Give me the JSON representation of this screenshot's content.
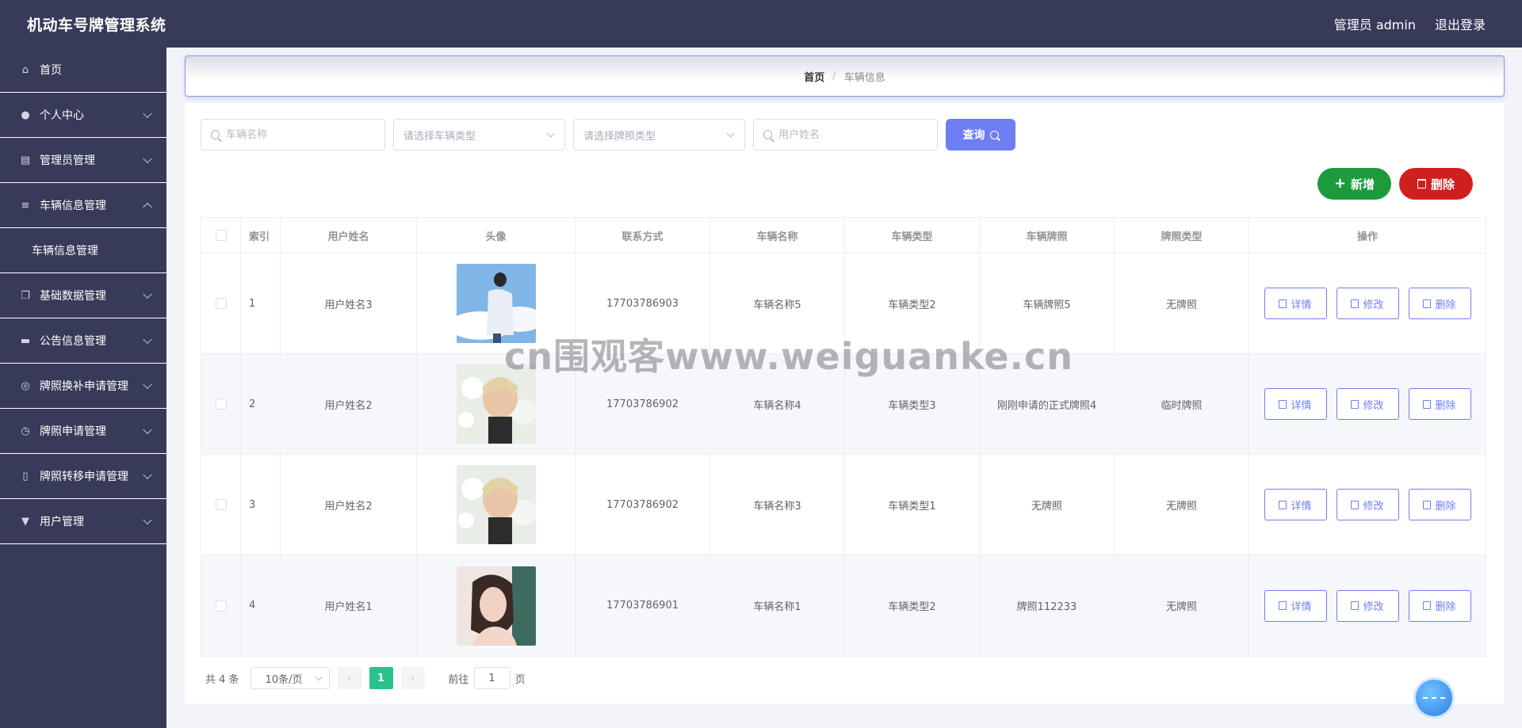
{
  "header": {
    "app_title": "机动车号牌管理系统",
    "user_label": "管理员 admin",
    "logout_label": "退出登录"
  },
  "sidebar": {
    "items": [
      {
        "label": "首页",
        "icon": "home-icon"
      },
      {
        "label": "个人中心",
        "icon": "user-icon"
      },
      {
        "label": "管理员管理",
        "icon": "chart-icon"
      },
      {
        "label": "车辆信息管理",
        "icon": "list-icon",
        "sub": "车辆信息管理"
      },
      {
        "label": "基础数据管理",
        "icon": "copy-icon"
      },
      {
        "label": "公告信息管理",
        "icon": "monitor-icon"
      },
      {
        "label": "牌照换补申请管理",
        "icon": "compass-icon"
      },
      {
        "label": "牌照申请管理",
        "icon": "clock-icon"
      },
      {
        "label": "牌照转移申请管理",
        "icon": "phone-icon"
      },
      {
        "label": "用户管理",
        "icon": "stamp-icon"
      }
    ]
  },
  "breadcrumb": {
    "home": "首页",
    "separator": "/",
    "current": "车辆信息"
  },
  "filters": {
    "vehicle_name_placeholder": "车辆名称",
    "vehicle_type_placeholder": "请选择车辆类型",
    "plate_type_placeholder": "请选择牌照类型",
    "user_name_placeholder": "用户姓名",
    "query_label": "查询"
  },
  "actions": {
    "add_label": "新增",
    "delete_label": "删除"
  },
  "table": {
    "headers": [
      "索引",
      "用户姓名",
      "头像",
      "联系方式",
      "车辆名称",
      "车辆类型",
      "车辆牌照",
      "牌照类型",
      "操作"
    ],
    "rows": [
      {
        "index": "1",
        "user": "用户姓名3",
        "phone": "17703786903",
        "car": "车辆名称5",
        "type": "车辆类型2",
        "plate": "车辆牌照5",
        "plate_type": "无牌照"
      },
      {
        "index": "2",
        "user": "用户姓名2",
        "phone": "17703786902",
        "car": "车辆名称4",
        "type": "车辆类型3",
        "plate": "刚刚申请的正式牌照4",
        "plate_type": "临时牌照"
      },
      {
        "index": "3",
        "user": "用户姓名2",
        "phone": "17703786902",
        "car": "车辆名称3",
        "type": "车辆类型1",
        "plate": "无牌照",
        "plate_type": "无牌照"
      },
      {
        "index": "4",
        "user": "用户姓名1",
        "phone": "17703786901",
        "car": "车辆名称1",
        "type": "车辆类型2",
        "plate": "牌照112233",
        "plate_type": "无牌照"
      }
    ],
    "row_actions": {
      "detail": "详情",
      "edit": "修改",
      "delete": "删除"
    }
  },
  "pagination": {
    "total": "共 4 条",
    "page_size": "10条/页",
    "current_page": "1",
    "goto_prefix": "前往",
    "goto_value": "1",
    "goto_suffix": "页"
  },
  "watermark": "cn围观客www.weiguanke.cn",
  "colors": {
    "sidebar_bg": "#373b59",
    "primary": "#6f7ef2",
    "add_green": "#1d9b3c",
    "delete_red": "#d01f1f",
    "page_active": "#28c28b"
  }
}
